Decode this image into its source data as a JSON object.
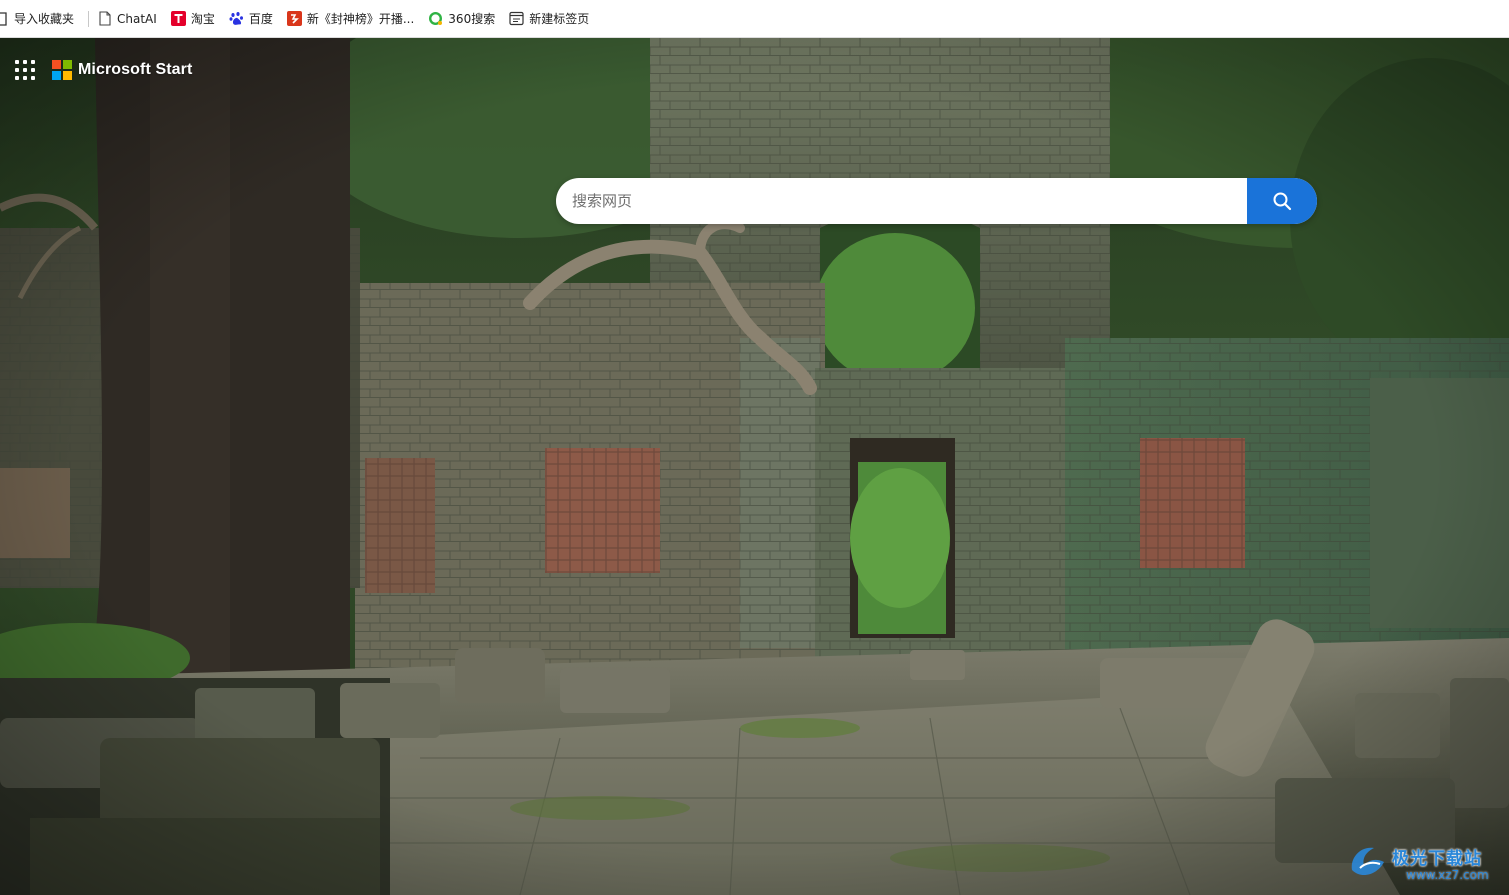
{
  "bookmarks_bar": {
    "items": [
      {
        "label": "导入收藏夹",
        "icon": "import-icon"
      },
      {
        "label": "ChatAI",
        "icon": "page-icon"
      },
      {
        "label": "淘宝",
        "icon": "taobao-icon"
      },
      {
        "label": "百度",
        "icon": "baidu-icon"
      },
      {
        "label": "新《封神榜》开播...",
        "icon": "video-icon"
      },
      {
        "label": "360搜索",
        "icon": "360-search-icon"
      },
      {
        "label": "新建标签页",
        "icon": "new-tab-icon"
      }
    ]
  },
  "header": {
    "app_launcher_icon": "app-launcher-icon",
    "brand": "Microsoft Start",
    "brand_colors": [
      "#f25022",
      "#7fba00",
      "#00a4ef",
      "#ffb900"
    ]
  },
  "search": {
    "placeholder": "搜索网页",
    "value": "",
    "button_icon": "search-icon",
    "accent": "#1a73d9"
  },
  "watermark": {
    "text": "极光下载站",
    "url": "www.xz7.com"
  }
}
